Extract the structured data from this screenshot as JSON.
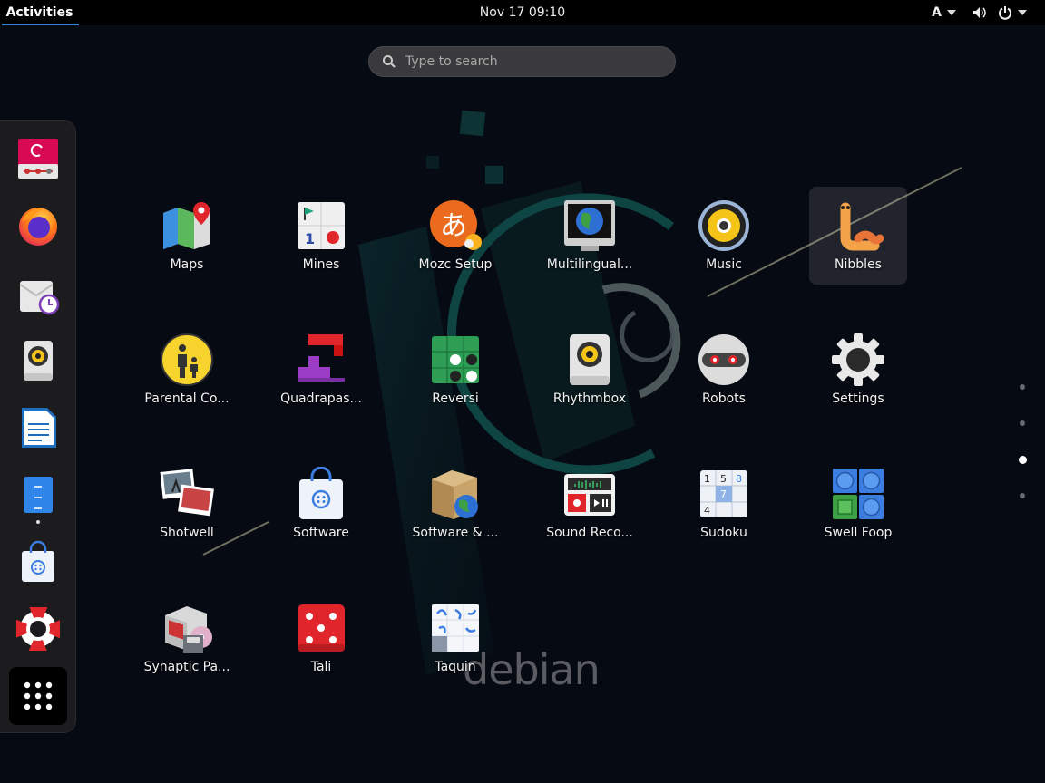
{
  "topbar": {
    "activities": "Activities",
    "clock": "Nov 17  09:10",
    "input_source": "A"
  },
  "search": {
    "placeholder": "Type to search"
  },
  "dock": {
    "items": [
      {
        "name": "debian-installer",
        "icon": "debian-installer-icon"
      },
      {
        "name": "firefox",
        "icon": "firefox-icon"
      },
      {
        "name": "evolution",
        "icon": "mail-clock-icon"
      },
      {
        "name": "rhythmbox",
        "icon": "speaker-icon"
      },
      {
        "name": "libreoffice-writer",
        "icon": "document-icon"
      },
      {
        "name": "files",
        "icon": "file-cabinet-icon"
      },
      {
        "name": "software",
        "icon": "shopping-bag-icon"
      },
      {
        "name": "help",
        "icon": "lifebuoy-icon"
      }
    ],
    "show_apps_icon": "app-grid-icon"
  },
  "apps": [
    {
      "label": "Maps",
      "icon": "map-icon"
    },
    {
      "label": "Mines",
      "icon": "mines-icon"
    },
    {
      "label": "Mozc Setup",
      "icon": "mozc-icon"
    },
    {
      "label": "Multilingual...",
      "icon": "globe-monitor-icon"
    },
    {
      "label": "Music",
      "icon": "music-speaker-icon"
    },
    {
      "label": "Nibbles",
      "icon": "worm-icon",
      "selected": true
    },
    {
      "label": "Parental Co...",
      "icon": "parental-icon"
    },
    {
      "label": "Quadrapas...",
      "icon": "blocks-icon"
    },
    {
      "label": "Reversi",
      "icon": "reversi-icon"
    },
    {
      "label": "Rhythmbox",
      "icon": "speaker-icon"
    },
    {
      "label": "Robots",
      "icon": "robot-icon"
    },
    {
      "label": "Settings",
      "icon": "gear-icon"
    },
    {
      "label": "Shotwell",
      "icon": "photos-icon"
    },
    {
      "label": "Software",
      "icon": "shopping-bag-icon"
    },
    {
      "label": "Software & ...",
      "icon": "package-globe-icon"
    },
    {
      "label": "Sound Reco...",
      "icon": "recorder-icon"
    },
    {
      "label": "Sudoku",
      "icon": "sudoku-icon"
    },
    {
      "label": "Swell Foop",
      "icon": "swell-foop-icon"
    },
    {
      "label": "Synaptic Pa...",
      "icon": "synaptic-icon"
    },
    {
      "label": "Tali",
      "icon": "dice-icon"
    },
    {
      "label": "Taquin",
      "icon": "taquin-icon"
    }
  ],
  "pages": {
    "count": 4,
    "active": 3
  },
  "wallpaper_text": "debian",
  "colors": {
    "accent": "#3584e4",
    "debian_red": "#d70a53",
    "panel": "#000000",
    "dock": "#1c1c1e"
  }
}
